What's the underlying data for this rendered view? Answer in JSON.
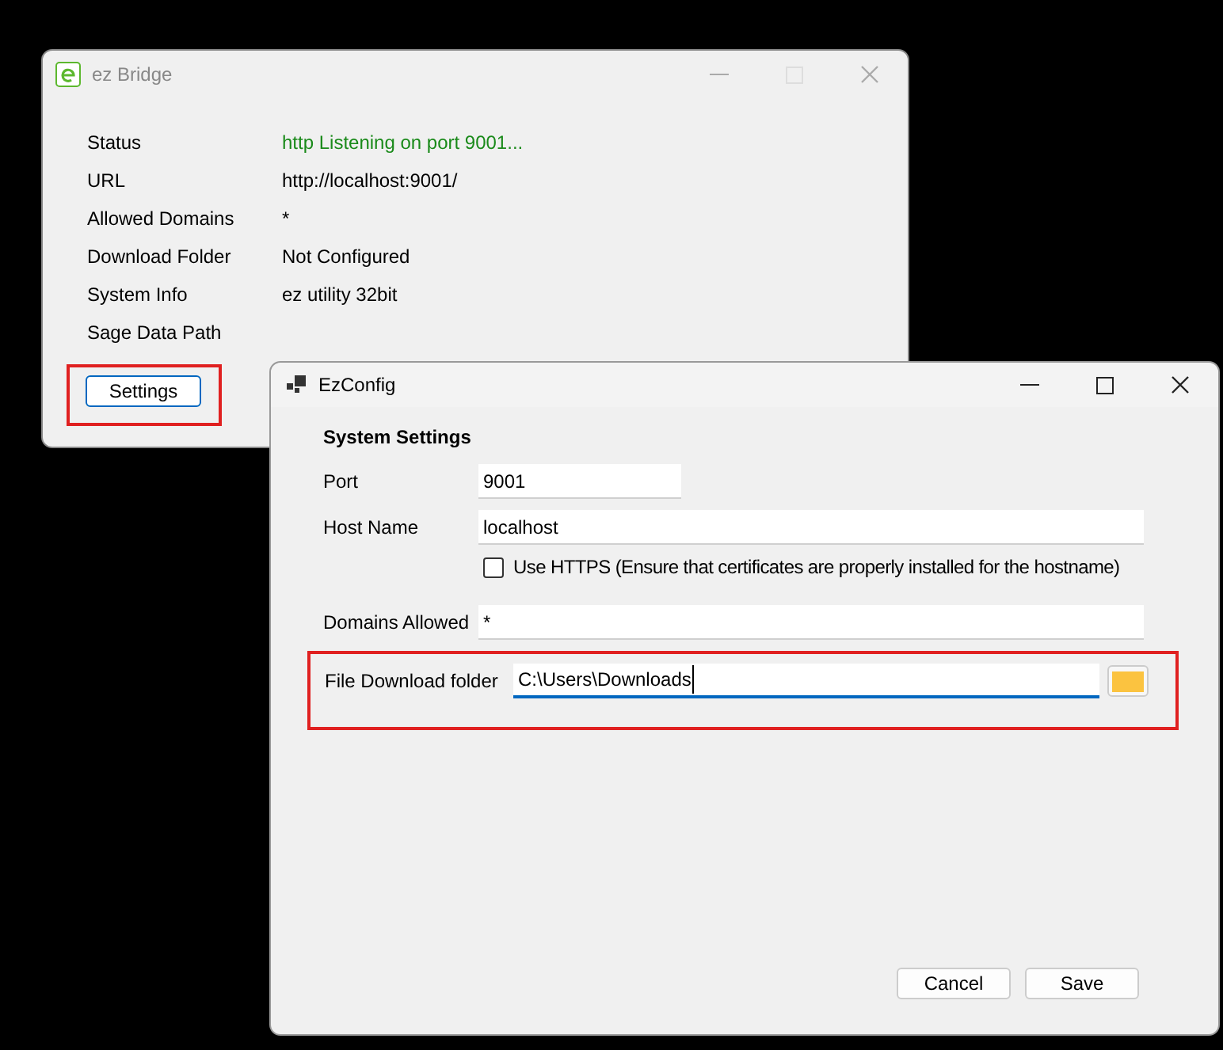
{
  "bridge_window": {
    "title": "ez Bridge",
    "active": false,
    "info_rows": [
      {
        "label": "Status",
        "value": "http Listening on port 9001...",
        "kind": "status"
      },
      {
        "label": "URL",
        "value": "http://localhost:9001/",
        "kind": "plain"
      },
      {
        "label": "Allowed Domains",
        "value": "*",
        "kind": "plain"
      },
      {
        "label": "Download Folder",
        "value": "Not Configured",
        "kind": "plain"
      },
      {
        "label": "System Info",
        "value": "ez utility 32bit",
        "kind": "plain"
      },
      {
        "label": "Sage Data Path",
        "kind": "plain"
      }
    ],
    "settings_button": "Settings"
  },
  "config_window": {
    "title": "EzConfig",
    "active": true,
    "section_title": "System Settings",
    "port": {
      "label": "Port",
      "value": "9001"
    },
    "host_name": {
      "label": "Host Name",
      "value": "localhost"
    },
    "use_https": {
      "label": "Use HTTPS (Ensure that certificates are properly installed for the hostname)",
      "checked": false
    },
    "domains_allowed": {
      "label": "Domains Allowed",
      "value": "*"
    },
    "download_folder": {
      "label": "File Download folder",
      "value": "C:\\Users\\Downloads",
      "focused": true
    },
    "buttons": [
      "Cancel",
      "Save"
    ]
  }
}
